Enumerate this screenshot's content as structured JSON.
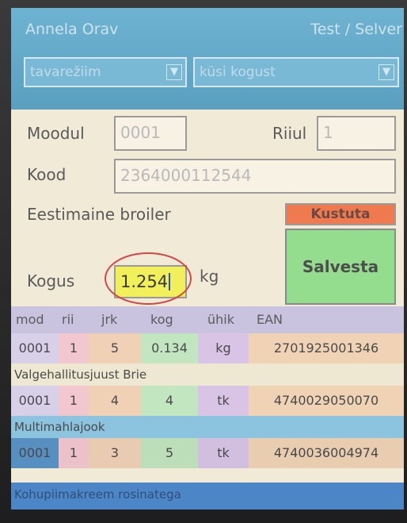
{
  "header": {
    "user": "Annela Orav",
    "mode": "Test / Selver"
  },
  "selects": [
    {
      "value": "tavarežiim",
      "arrow": "▼"
    },
    {
      "value": "küsi kogust",
      "arrow": "▼"
    }
  ],
  "form": {
    "moodul_label": "Moodul",
    "moodul_value": "0001",
    "riiul_label": "Riiul",
    "riiul_value": "1",
    "kood_label": "Kood",
    "kood_value": "2364000112544",
    "product_name": "Eestimaine broiler",
    "kogus_label": "Kogus",
    "kogus_value": "1.254",
    "unit": "kg"
  },
  "buttons": {
    "delete": "Kustuta",
    "save": "Salvesta"
  },
  "table": {
    "headers": [
      "mod",
      "rii",
      "jrk",
      "kog",
      "ühik",
      "EAN"
    ],
    "rows": [
      {
        "mod": "0001",
        "rii": "1",
        "jrk": "5",
        "kog": "0.134",
        "uhik": "kg",
        "ean": "2701925001346",
        "name": "Valgehallitusjuust Brie"
      },
      {
        "mod": "0001",
        "rii": "1",
        "jrk": "4",
        "kog": "4",
        "uhik": "tk",
        "ean": "4740029050070",
        "name": "Multimahlajook"
      },
      {
        "mod": "0001",
        "rii": "1",
        "jrk": "3",
        "kog": "5",
        "uhik": "tk",
        "ean": "4740036004974",
        "name": "Kohupiimakreem rosinatega"
      }
    ]
  },
  "colors": {
    "header_bg": "#6fb3d2",
    "delete_bg": "#f07a4f",
    "save_bg": "#95dd8e",
    "input_highlight": "#f2f05a",
    "annotation_circle": "#d24848"
  }
}
